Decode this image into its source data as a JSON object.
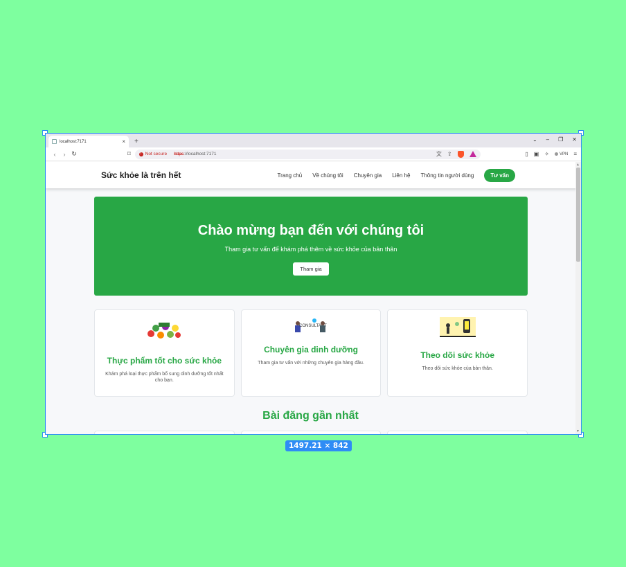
{
  "browser": {
    "tab_title": "localhost:7171",
    "tab_close": "×",
    "new_tab": "+",
    "window_controls": [
      "⌄",
      "–",
      "❐",
      "✕"
    ],
    "security_label": "Not secure",
    "url_scheme": "https",
    "url_rest": "://localhost:7171",
    "vpn_label": "VPN"
  },
  "site": {
    "brand": "Sức khỏe là trên hết",
    "nav": [
      "Trang chủ",
      "Về chúng tôi",
      "Chuyên gia",
      "Liên hệ",
      "Thông tin người dùng"
    ],
    "cta": "Tư vấn"
  },
  "hero": {
    "title": "Chào mừng bạn đến với chúng tôi",
    "subtitle": "Tham gia tư vấn để khám phá thêm về sức khỏe của bản thân",
    "button": "Tham gia"
  },
  "cards": [
    {
      "title": "Thực phẩm tốt cho sức khỏe",
      "text": "Khám phá loại thực phẩm bổ sung dinh dưỡng tốt nhất cho bạn.",
      "icon": "healthy-food-illustration"
    },
    {
      "title": "Chuyên gia dinh dưỡng",
      "text": "Tham gia tư vấn với những chuyên gia hàng đầu.",
      "icon": "consultant-illustration",
      "image_text": "CONSULTANT"
    },
    {
      "title": "Theo dõi sức khỏe",
      "text": "Theo dõi sức khỏe của bản thân.",
      "icon": "health-tracking-illustration"
    }
  ],
  "recent_posts_title": "Bài đăng gần nhất",
  "dimension_badge": "1497.21 × 842",
  "colors": {
    "accent": "#28a745",
    "selection": "#2f8cf5",
    "background": "#7eff9f"
  }
}
